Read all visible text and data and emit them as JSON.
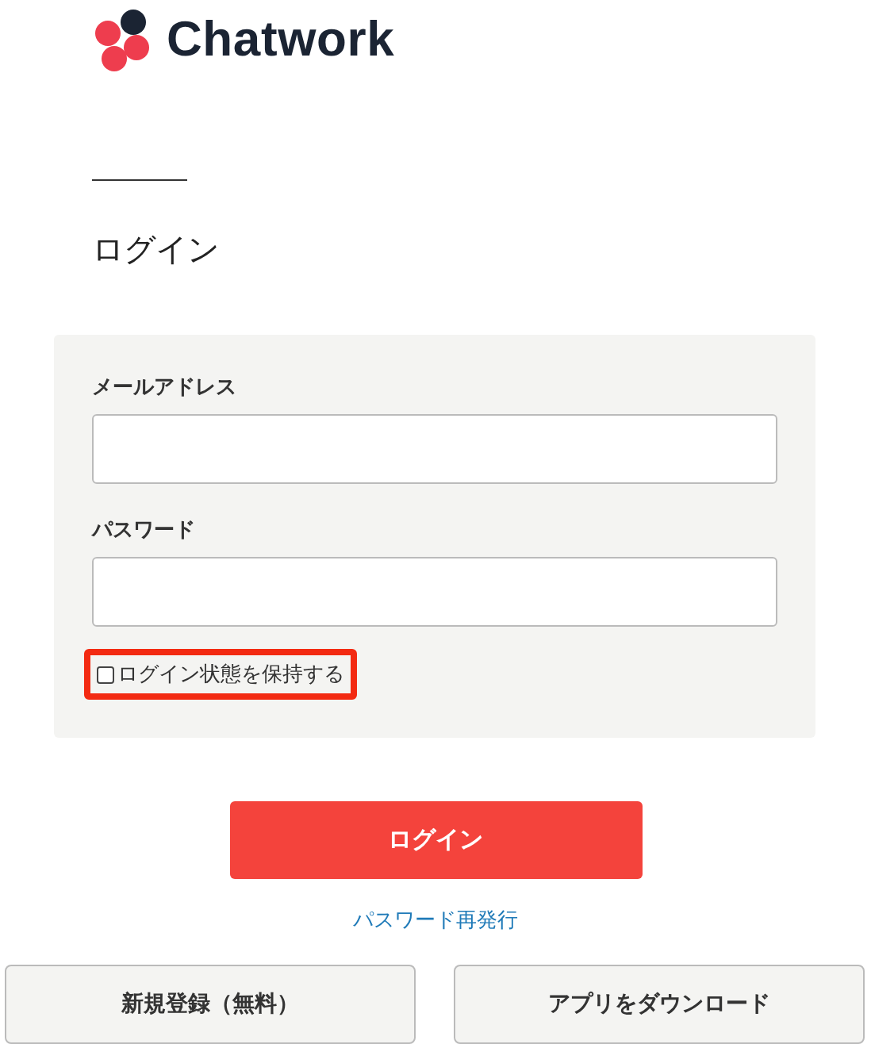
{
  "logo": {
    "text": "Chatwork"
  },
  "heading": "ログイン",
  "form": {
    "fields": [
      {
        "label": "メールアドレス"
      },
      {
        "label": "パスワード"
      }
    ],
    "remember": {
      "label": "ログイン状態を保持する",
      "checked": false,
      "highlighted": true
    }
  },
  "login_button": "ログイン",
  "reset_link": "パスワード再発行",
  "bottom_buttons": [
    "新規登録（無料）",
    "アプリをダウンロード"
  ]
}
